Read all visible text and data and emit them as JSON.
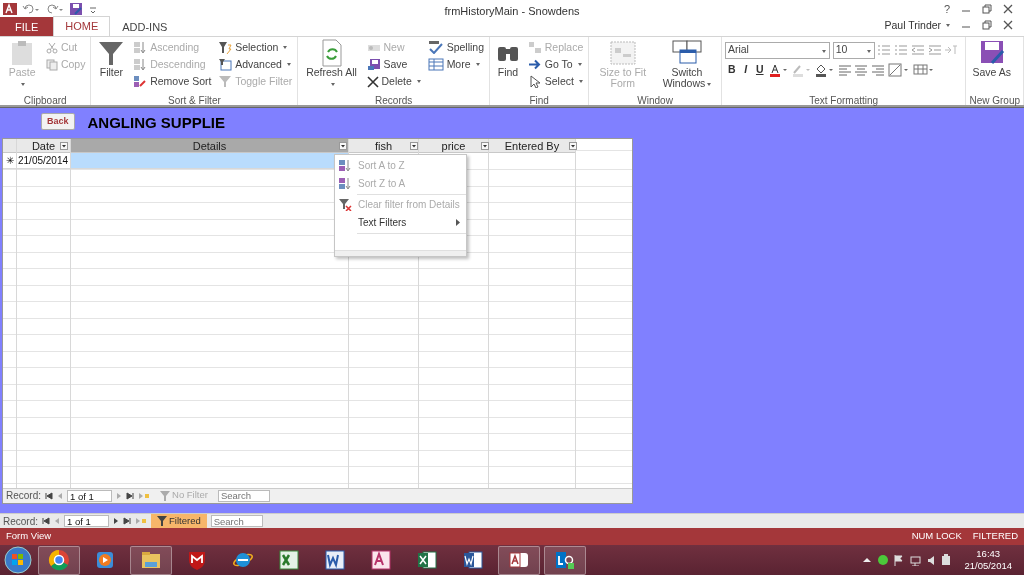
{
  "window": {
    "title": "frmHistoryMain - Snowdens",
    "help": "?",
    "user": "Paul Trinder"
  },
  "tabs": [
    {
      "label": "FILE",
      "kind": "file",
      "selected": false
    },
    {
      "label": "HOME",
      "kind": "tab",
      "selected": true
    },
    {
      "label": "ADD-INS",
      "kind": "tab",
      "selected": false
    }
  ],
  "ribbon": [
    {
      "label": "Clipboard",
      "kind": "buttons",
      "items": [
        {
          "label": "Paste",
          "kind": "large",
          "disabled": true,
          "dropdown": true
        },
        {
          "label": "Cut",
          "kind": "small",
          "disabled": true,
          "dropdown": false
        },
        {
          "label": "Copy",
          "kind": "small",
          "disabled": true,
          "dropdown": false
        }
      ]
    },
    {
      "label": "Sort & Filter",
      "kind": "buttons",
      "items": [
        {
          "label": "Filter",
          "kind": "large",
          "disabled": false,
          "dropdown": false
        },
        {
          "label": "Ascending",
          "kind": "small",
          "disabled": true,
          "dropdown": false
        },
        {
          "label": "Descending",
          "kind": "small",
          "disabled": true,
          "dropdown": false
        },
        {
          "label": "Remove Sort",
          "kind": "small",
          "disabled": false,
          "dropdown": false
        },
        {
          "label": "Selection",
          "kind": "small",
          "disabled": false,
          "dropdown": true
        },
        {
          "label": "Advanced",
          "kind": "small",
          "disabled": false,
          "dropdown": true
        },
        {
          "label": "Toggle Filter",
          "kind": "small",
          "disabled": true,
          "dropdown": false
        }
      ]
    },
    {
      "label": "Records",
      "kind": "buttons",
      "items": [
        {
          "label": "Refresh All",
          "kind": "large",
          "disabled": false,
          "dropdown": true
        },
        {
          "label": "New",
          "kind": "small",
          "disabled": true,
          "dropdown": false
        },
        {
          "label": "Save",
          "kind": "small",
          "disabled": false,
          "dropdown": false
        },
        {
          "label": "Delete",
          "kind": "small",
          "disabled": false,
          "dropdown": true
        },
        {
          "label": "Spelling",
          "kind": "small",
          "disabled": false,
          "dropdown": false
        },
        {
          "label": "More",
          "kind": "small",
          "disabled": false,
          "dropdown": true
        }
      ]
    },
    {
      "label": "Find",
      "kind": "buttons",
      "items": [
        {
          "label": "Find",
          "kind": "large",
          "disabled": false,
          "dropdown": false
        },
        {
          "label": "Replace",
          "kind": "small",
          "disabled": true,
          "dropdown": false
        },
        {
          "label": "Go To",
          "kind": "small",
          "disabled": false,
          "dropdown": true
        },
        {
          "label": "Select",
          "kind": "small",
          "disabled": false,
          "dropdown": true
        }
      ]
    },
    {
      "label": "Window",
      "kind": "buttons",
      "items": [
        {
          "label": "Size to Fit Form",
          "kind": "large",
          "disabled": true,
          "dropdown": false
        },
        {
          "label": "Switch Windows",
          "kind": "large",
          "disabled": false,
          "dropdown": true
        }
      ]
    },
    {
      "label": "Text Formatting",
      "kind": "text",
      "font": "Arial",
      "size": "10",
      "styles": [
        "B",
        "I",
        "U"
      ]
    },
    {
      "label": "New Group",
      "kind": "buttons",
      "items": [
        {
          "label": "Save As",
          "kind": "large",
          "disabled": false,
          "dropdown": false
        }
      ]
    }
  ],
  "form": {
    "back": "Back",
    "title": "ANGLING SUPPLIE"
  },
  "datasheet": {
    "columns": [
      {
        "label": "Date",
        "selected": false
      },
      {
        "label": "Details",
        "selected": true
      },
      {
        "label": "fish",
        "selected": false
      },
      {
        "label": "price",
        "selected": false
      },
      {
        "label": "Entered By",
        "selected": false
      }
    ],
    "new_row": {
      "marker": "✳",
      "date": "21/05/2014"
    },
    "menu": [
      {
        "label": "Sort A to Z",
        "kind": "sort-asc",
        "disabled": true
      },
      {
        "label": "Sort Z to A",
        "kind": "sort-desc",
        "disabled": true
      },
      {
        "label": "Clear filter from Details",
        "kind": "clear-filter",
        "disabled": true
      },
      {
        "label": "Text Filters",
        "kind": "submenu",
        "disabled": false
      }
    ],
    "nav": {
      "label": "Record:",
      "position": "1 of 1",
      "filter": "No Filter",
      "filtered": false,
      "placeholder": "Search"
    }
  },
  "form_nav": {
    "label": "Record:",
    "position": "1 of 1",
    "filter": "Filtered",
    "filtered": true,
    "placeholder": "Search"
  },
  "status_bar": {
    "view": "Form View",
    "indicators": [
      "NUM LOCK",
      "FILTERED"
    ]
  },
  "taskbar": {
    "apps": [
      {
        "kind": "chrome",
        "running": true
      },
      {
        "kind": "media",
        "running": false
      },
      {
        "kind": "folder",
        "running": true
      },
      {
        "kind": "shield",
        "running": false
      },
      {
        "kind": "ie",
        "running": false
      },
      {
        "kind": "excel-old",
        "running": false
      },
      {
        "kind": "word-old",
        "running": false
      },
      {
        "kind": "access-old",
        "running": false
      },
      {
        "kind": "excel",
        "running": false
      },
      {
        "kind": "word",
        "running": false
      },
      {
        "kind": "access",
        "running": true
      },
      {
        "kind": "lync",
        "running": true
      }
    ],
    "time": "16:43",
    "date": "21/05/2014"
  }
}
